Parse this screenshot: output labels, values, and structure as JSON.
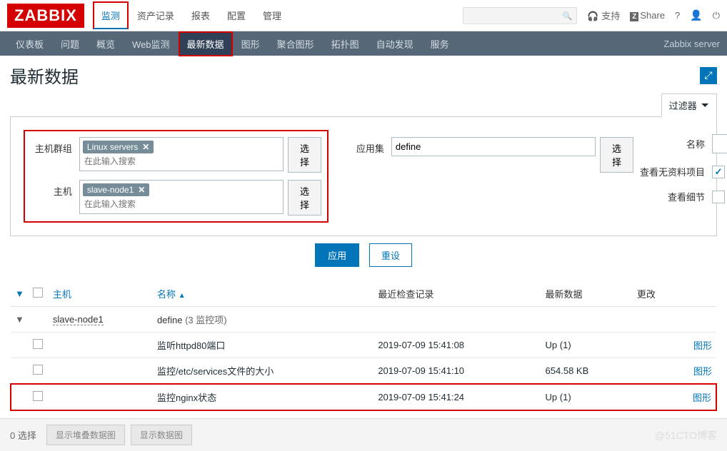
{
  "logo": "ZABBIX",
  "topnav": [
    "监测",
    "资产记录",
    "报表",
    "配置",
    "管理"
  ],
  "topnav_active": 0,
  "topright": {
    "support": "支持",
    "share": "Share"
  },
  "subnav": [
    "仪表板",
    "问题",
    "概览",
    "Web监测",
    "最新数据",
    "图形",
    "聚合图形",
    "拓扑图",
    "自动发现",
    "服务"
  ],
  "subnav_active": 4,
  "server_label": "Zabbix server",
  "page_title": "最新数据",
  "filter_tab": "过滤器",
  "filter": {
    "hostgroup_label": "主机群组",
    "hostgroup_tag": "Linux servers",
    "host_label": "主机",
    "host_tag": "slave-node1",
    "placeholder": "在此输入搜索",
    "select_btn": "选择",
    "appset_label": "应用集",
    "appset_value": "define",
    "name_label": "名称",
    "showempty_label": "查看无资料项目",
    "showdetails_label": "查看细节",
    "apply": "应用",
    "reset": "重设"
  },
  "columns": {
    "host": "主机",
    "name": "名称",
    "lastcheck": "最近检查记录",
    "latestdata": "最新数据",
    "change": "更改"
  },
  "group_row": {
    "host": "slave-node1",
    "app": "define",
    "count": "(3 监控项)"
  },
  "rows": [
    {
      "name": "监听httpd80端口",
      "time": "2019-07-09 15:41:08",
      "value": "Up (1)",
      "link": "图形"
    },
    {
      "name": "监控/etc/services文件的大小",
      "time": "2019-07-09 15:41:10",
      "value": "654.58 KB",
      "link": "图形"
    },
    {
      "name": "监控nginx状态",
      "time": "2019-07-09 15:41:24",
      "value": "Up (1)",
      "link": "图形",
      "highlight": true
    }
  ],
  "footer": {
    "selected": "0 选择",
    "stacked": "显示堆叠数据图",
    "graph": "显示数据图",
    "watermark": "@51CTO博客"
  }
}
